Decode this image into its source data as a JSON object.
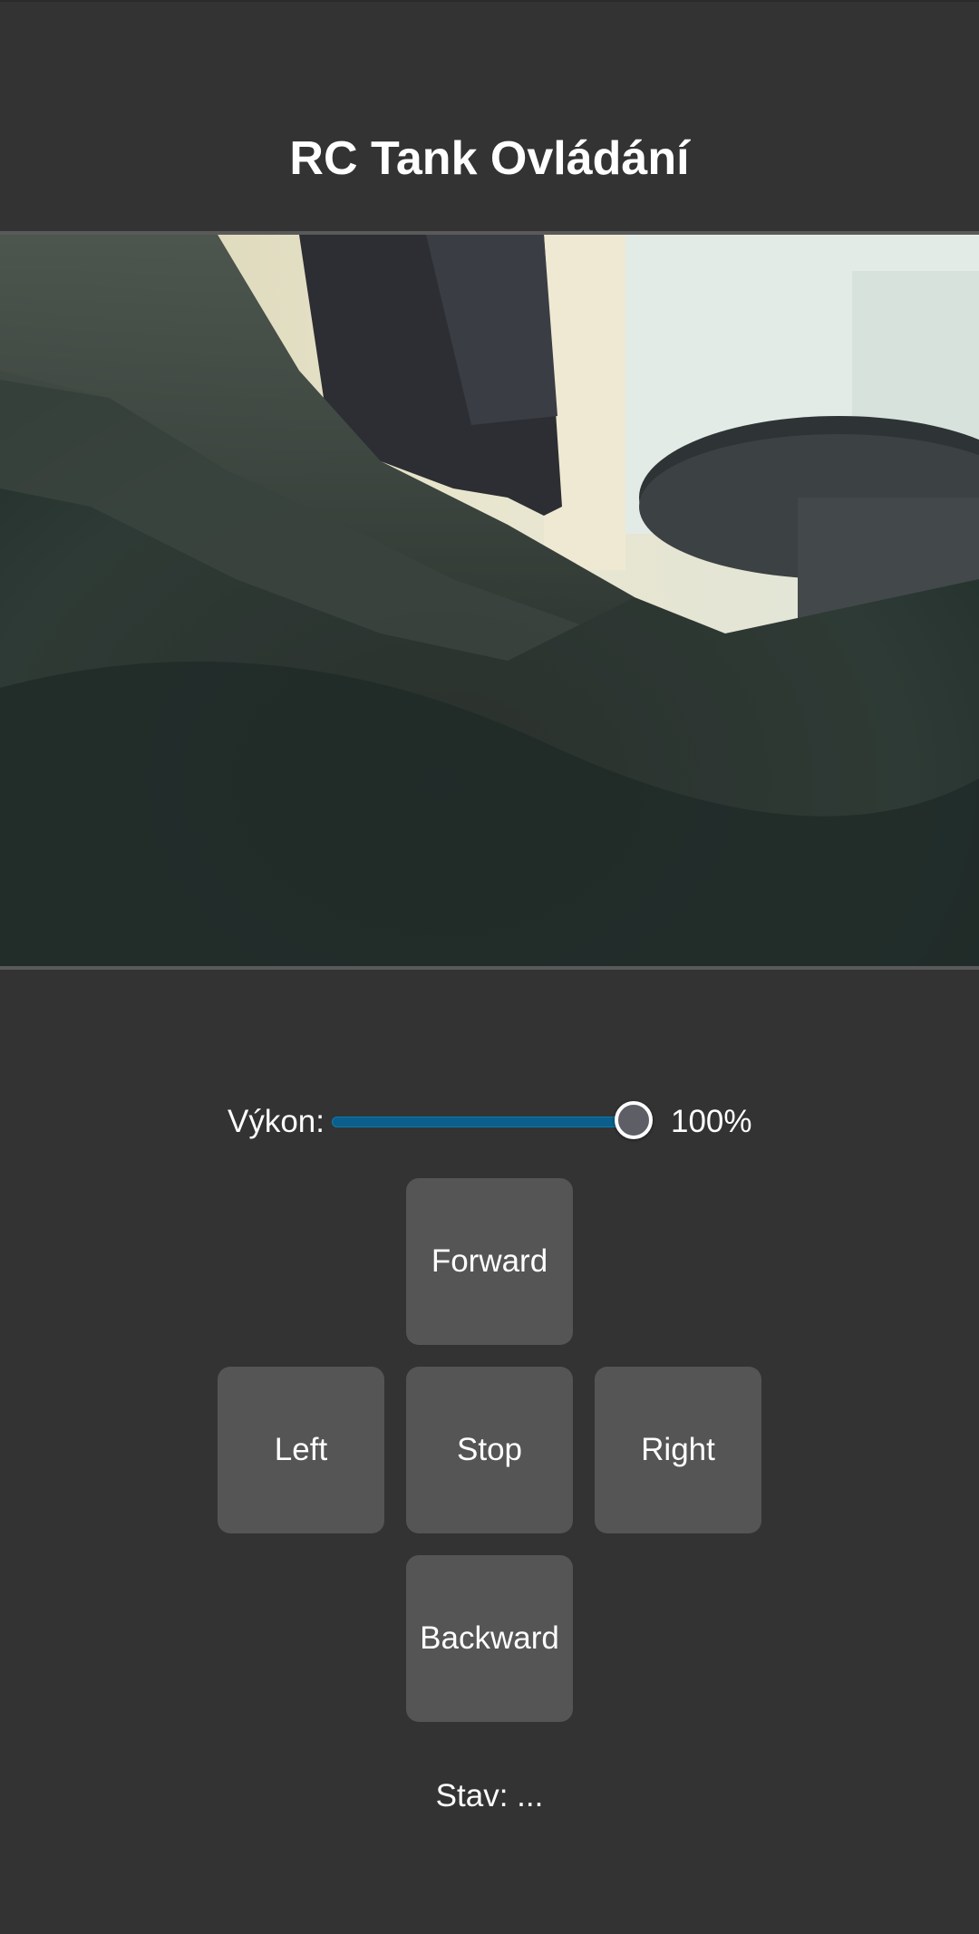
{
  "header": {
    "title": "RC Tank Ovládání"
  },
  "camera": {
    "description_icon": "camera-feed"
  },
  "controls": {
    "power_label": "Výkon:",
    "power_value": 1.0,
    "power_text": "100%",
    "forward_label": "Forward",
    "left_label": "Left",
    "stop_label": "Stop",
    "right_label": "Right",
    "backward_label": "Backward"
  },
  "status": {
    "text": "Stav: ..."
  },
  "colors": {
    "background": "#333333",
    "button": "#555555",
    "slider_fill": "#0a5f8c",
    "text": "#ffffff"
  }
}
